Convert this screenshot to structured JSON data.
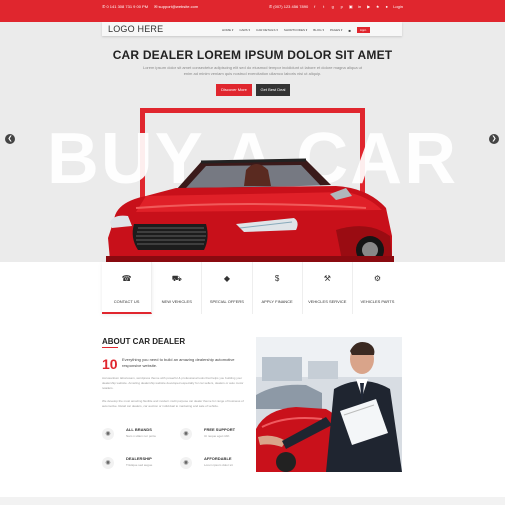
{
  "topbar": {
    "phone": "✆ 0 141 308 731 9 00 PM",
    "email": "✉ support@website.com",
    "phone2": "✆ (007) 123 456 7890",
    "login": "Login",
    "social": [
      "f",
      "t",
      "g",
      "p",
      "▣",
      "in",
      "▶",
      "★",
      "●"
    ]
  },
  "nav": {
    "logo": "LOGO HERE",
    "items": [
      "HOME ▾",
      "CARS ▾",
      "CAR DETAILS ▾",
      "SHORTCODES ▾",
      "BLOG ▾",
      "PAGES ▾"
    ],
    "cart": "■",
    "appointment": "Appt."
  },
  "hero": {
    "headline": "CAR DEALER LOREM IPSUM DOLOR SIT AMET",
    "text": "Lorem ipsum dolor sit amet consectetur adipiscing elit sed do eiusmod tempor incididunt ut labore et dolore magna aliqua ut enim ad minim veniam quis nostrud exercitation ullamco laboris nisi ut aliquip.",
    "btn_primary": "Discover More",
    "btn_secondary": "Get Best Deal",
    "big_text": "BUY A CAR"
  },
  "services": [
    {
      "icon": "☎",
      "label": "CONTACT US",
      "active": true
    },
    {
      "icon": "⛟",
      "label": "NEW VEHICLES",
      "active": false
    },
    {
      "icon": "◆",
      "label": "SPECIAL OFFERS",
      "active": false
    },
    {
      "icon": "$",
      "label": "APPLY FINANCE",
      "active": false
    },
    {
      "icon": "⚒",
      "label": "VEHICLES SERVICE",
      "active": false
    },
    {
      "icon": "⚙",
      "label": "VEHICLES PARTS",
      "active": false
    }
  ],
  "about": {
    "title": "ABOUT CAR DEALER",
    "number": "10",
    "lead": "Everything you need to build an amazing dealership automotive responsive website.",
    "para1": "Accusantium laboriosam, wordpress theme with powerful & professional tools that helps you building your dealership website. Amazing dealership website developed especially for car sellers, dealers or auto motor retailers.",
    "para2": "We develop the most amazing flexible and modern multi purpose car dealer theme for range of business of automotive. Retail car dealers, car auction or individual to marketing and sale of vehicle.",
    "features": [
      {
        "icon": "◉",
        "title": "ALL BRANDS",
        "sub": "Nam n ullam nor porta"
      },
      {
        "icon": "◉",
        "title": "FREE SUPPORT",
        "sub": "Ut neque eget nibh"
      },
      {
        "icon": "◉",
        "title": "DEALERSHIP",
        "sub": "Tristique sed augue"
      },
      {
        "icon": "◉",
        "title": "AFFORDABLE",
        "sub": "Lorem ipsum dolor sit"
      }
    ]
  },
  "colors": {
    "accent": "#e0262e",
    "dark": "#333333",
    "hero_bg": "#ebebeb"
  }
}
